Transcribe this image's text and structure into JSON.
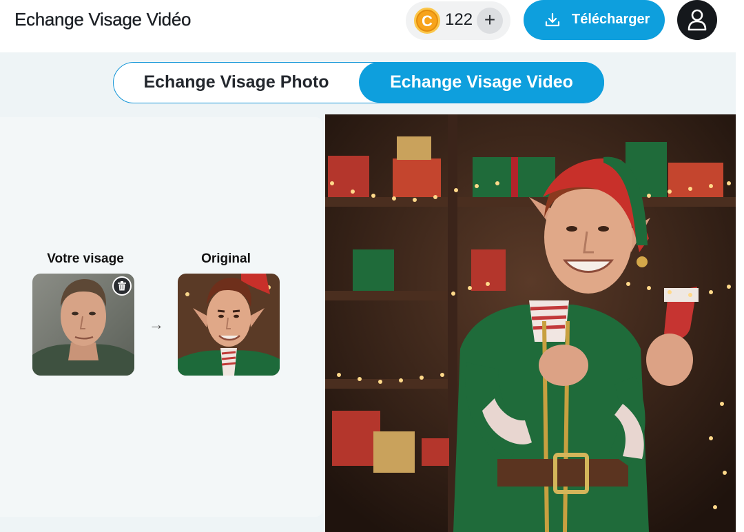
{
  "header": {
    "title": "Echange Visage Vidéo",
    "credits": {
      "count": "122",
      "coin_symbol": "C",
      "add_symbol": "+"
    },
    "download_label": "Télécharger"
  },
  "mode_tabs": [
    {
      "label": "Echange Visage Photo",
      "active": false
    },
    {
      "label": "Echange Visage Video",
      "active": true
    }
  ],
  "swap": {
    "your_face_label": "Votre visage",
    "original_label": "Original",
    "arrow": "→"
  },
  "icons": {
    "coin": "coin-icon",
    "add": "plus-icon",
    "download": "download-icon",
    "user": "user-icon",
    "delete": "trash-icon"
  },
  "colors": {
    "accent": "#0e9fdd",
    "background": "#eef4f6",
    "coin": "#f7a31a"
  }
}
